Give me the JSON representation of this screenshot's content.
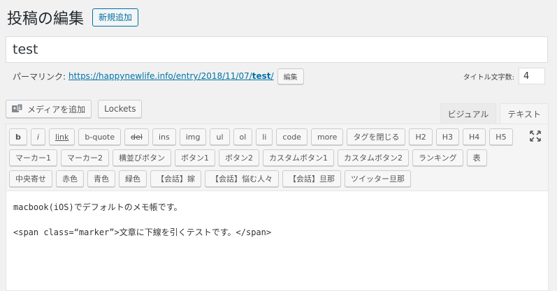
{
  "header": {
    "title": "投稿の編集",
    "add_new": "新規追加"
  },
  "post": {
    "title": "test"
  },
  "permalink": {
    "label": "パーマリンク:",
    "url_base": "https://happynewlife.info/entry/2018/11/07/",
    "slug": "test",
    "url_end": "/",
    "edit_button": "編集"
  },
  "title_count": {
    "label": "タイトル文字数:",
    "value": "4"
  },
  "media": {
    "add_media": "メディアを追加",
    "lockets": "Lockets"
  },
  "tabs": {
    "visual": "ビジュアル",
    "text": "テキスト"
  },
  "toolbar": {
    "row1": [
      "b",
      "i",
      "link",
      "b-quote",
      "del",
      "ins",
      "img",
      "ul",
      "ol",
      "li",
      "code",
      "more",
      "タグを閉じる",
      "H2",
      "H3",
      "H4",
      "H5"
    ],
    "row2": [
      "マーカー1",
      "マーカー2",
      "横並びボタン",
      "ボタン1",
      "ボタン2",
      "カスタムボタン1",
      "カスタムボタン2",
      "ランキング",
      "表"
    ],
    "row3": [
      "中央寄せ",
      "赤色",
      "青色",
      "緑色",
      "【会話】嫁",
      "【会話】悩む人々",
      "【会話】旦那",
      "ツイッター旦那"
    ]
  },
  "content": {
    "line1": "macbook(iOS)でデフォルトのメモ帳です。",
    "line2": "<span class=“marker”>文章に下線を引くテストです。</span>"
  },
  "colors": {
    "link": "#0073aa",
    "accent": "#0071a1"
  }
}
